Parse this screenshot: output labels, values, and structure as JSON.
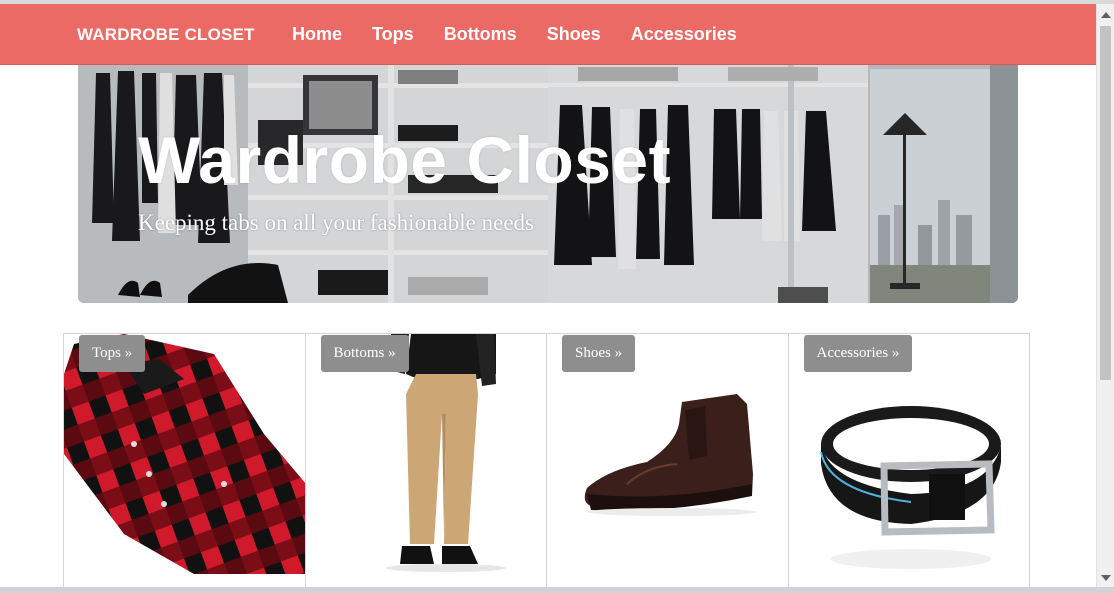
{
  "navbar": {
    "brand": "WARDROBE CLOSET",
    "links": [
      "Home",
      "Tops",
      "Bottoms",
      "Shoes",
      "Accessories"
    ],
    "background_color": "#ec6a66"
  },
  "hero": {
    "title": "Wardrobe Closet",
    "subtitle": "Keeping tabs on all your fashionable needs"
  },
  "tiles": [
    {
      "label": "Tops »",
      "image": "red-plaid-shirt"
    },
    {
      "label": "Bottoms »",
      "image": "khaki-pants"
    },
    {
      "label": "Shoes »",
      "image": "brown-brogue-boot"
    },
    {
      "label": "Accessories »",
      "image": "black-leather-belt"
    }
  ]
}
